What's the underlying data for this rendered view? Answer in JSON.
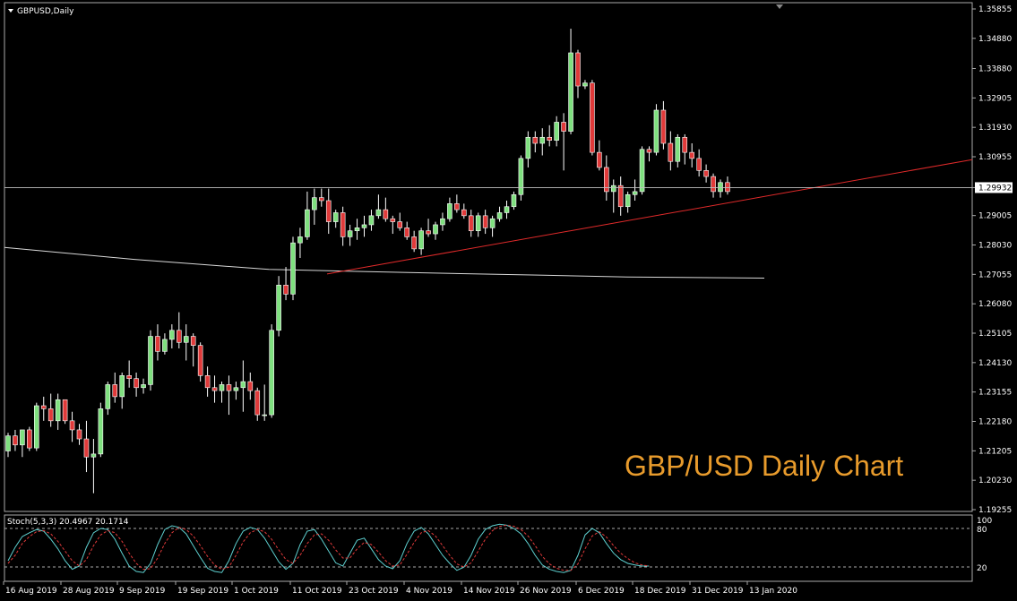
{
  "window": {
    "symbol_label": "GBPUSD,Daily"
  },
  "indicator": {
    "label": "Stoch(5,3,3) 20.4967 20.1714",
    "level_high": "80",
    "level_low": "20",
    "max": "100"
  },
  "watermark": "GBP/USD Daily Chart",
  "colors": {
    "background": "#000000",
    "bull": "#7fe07f",
    "bear": "#e03a3a",
    "trendline": "#e02a2a",
    "ma": "#d8d8d8",
    "stoch_main": "#5ed0d0",
    "stoch_signal": "#e03a3a",
    "watermark": "#e89b2c",
    "bid_line": "#c0c0c0"
  },
  "chart_data": {
    "type": "candlestick",
    "symbol": "GBPUSD",
    "timeframe": "Daily",
    "current_price": "1.29932",
    "y_ticks": [
      "1.35855",
      "1.34880",
      "1.33880",
      "1.32905",
      "1.31930",
      "1.30955",
      "1.29932",
      "1.29005",
      "1.28030",
      "1.27055",
      "1.26080",
      "1.25105",
      "1.24130",
      "1.23155",
      "1.22180",
      "1.21205",
      "1.20230",
      "1.19255"
    ],
    "ylim": [
      1.19255,
      1.35855
    ],
    "x_ticks": [
      "16 Aug 2019",
      "28 Aug 2019",
      "9 Sep 2019",
      "19 Sep 2019",
      "1 Oct 2019",
      "11 Oct 2019",
      "23 Oct 2019",
      "4 Nov 2019",
      "14 Nov 2019",
      "26 Nov 2019",
      "6 Dec 2019",
      "18 Dec 2019",
      "31 Dec 2019",
      "13 Jan 2020"
    ],
    "candles": [
      [
        1.212,
        1.218,
        1.21,
        1.217
      ],
      [
        1.217,
        1.219,
        1.212,
        1.214
      ],
      [
        1.214,
        1.219,
        1.21,
        1.219
      ],
      [
        1.219,
        1.22,
        1.212,
        1.213
      ],
      [
        1.213,
        1.228,
        1.212,
        1.227
      ],
      [
        1.227,
        1.23,
        1.222,
        1.226
      ],
      [
        1.226,
        1.231,
        1.22,
        1.222
      ],
      [
        1.222,
        1.231,
        1.219,
        1.229
      ],
      [
        1.229,
        1.229,
        1.221,
        1.222
      ],
      [
        1.222,
        1.225,
        1.215,
        1.219
      ],
      [
        1.219,
        1.221,
        1.214,
        1.216
      ],
      [
        1.216,
        1.222,
        1.205,
        1.21
      ],
      [
        1.21,
        1.216,
        1.198,
        1.211
      ],
      [
        1.211,
        1.228,
        1.21,
        1.226
      ],
      [
        1.226,
        1.235,
        1.224,
        1.234
      ],
      [
        1.234,
        1.238,
        1.228,
        1.23
      ],
      [
        1.23,
        1.238,
        1.226,
        1.237
      ],
      [
        1.237,
        1.242,
        1.233,
        1.236
      ],
      [
        1.236,
        1.238,
        1.23,
        1.233
      ],
      [
        1.233,
        1.236,
        1.231,
        1.234
      ],
      [
        1.234,
        1.252,
        1.232,
        1.25
      ],
      [
        1.25,
        1.254,
        1.242,
        1.245
      ],
      [
        1.245,
        1.251,
        1.244,
        1.249
      ],
      [
        1.249,
        1.254,
        1.246,
        1.252
      ],
      [
        1.252,
        1.258,
        1.246,
        1.248
      ],
      [
        1.248,
        1.254,
        1.242,
        1.25
      ],
      [
        1.25,
        1.251,
        1.24,
        1.247
      ],
      [
        1.247,
        1.248,
        1.235,
        1.237
      ],
      [
        1.237,
        1.24,
        1.23,
        1.233
      ],
      [
        1.233,
        1.237,
        1.228,
        1.232
      ],
      [
        1.232,
        1.235,
        1.228,
        1.234
      ],
      [
        1.234,
        1.237,
        1.224,
        1.232
      ],
      [
        1.232,
        1.235,
        1.229,
        1.233
      ],
      [
        1.233,
        1.242,
        1.225,
        1.235
      ],
      [
        1.235,
        1.238,
        1.229,
        1.232
      ],
      [
        1.232,
        1.233,
        1.222,
        1.224
      ],
      [
        1.224,
        1.234,
        1.222,
        1.224
      ],
      [
        1.224,
        1.254,
        1.223,
        1.252
      ],
      [
        1.252,
        1.27,
        1.25,
        1.267
      ],
      [
        1.267,
        1.273,
        1.262,
        1.264
      ],
      [
        1.264,
        1.283,
        1.262,
        1.281
      ],
      [
        1.281,
        1.286,
        1.276,
        1.283
      ],
      [
        1.283,
        1.298,
        1.282,
        1.292
      ],
      [
        1.292,
        1.299,
        1.287,
        1.296
      ],
      [
        1.296,
        1.299,
        1.293,
        1.295
      ],
      [
        1.295,
        1.299,
        1.284,
        1.288
      ],
      [
        1.288,
        1.292,
        1.286,
        1.291
      ],
      [
        1.291,
        1.293,
        1.28,
        1.283
      ],
      [
        1.283,
        1.287,
        1.28,
        1.285
      ],
      [
        1.285,
        1.289,
        1.282,
        1.286
      ],
      [
        1.286,
        1.29,
        1.283,
        1.287
      ],
      [
        1.287,
        1.292,
        1.285,
        1.29
      ],
      [
        1.29,
        1.297,
        1.289,
        1.292
      ],
      [
        1.292,
        1.296,
        1.288,
        1.289
      ],
      [
        1.289,
        1.29,
        1.284,
        1.288
      ],
      [
        1.288,
        1.291,
        1.285,
        1.286
      ],
      [
        1.286,
        1.288,
        1.282,
        1.283
      ],
      [
        1.283,
        1.285,
        1.278,
        1.279
      ],
      [
        1.279,
        1.286,
        1.277,
        1.285
      ],
      [
        1.285,
        1.289,
        1.283,
        1.284
      ],
      [
        1.284,
        1.288,
        1.282,
        1.287
      ],
      [
        1.287,
        1.291,
        1.285,
        1.289
      ],
      [
        1.289,
        1.296,
        1.288,
        1.294
      ],
      [
        1.294,
        1.297,
        1.291,
        1.292
      ],
      [
        1.292,
        1.294,
        1.289,
        1.29
      ],
      [
        1.29,
        1.292,
        1.283,
        1.285
      ],
      [
        1.285,
        1.291,
        1.283,
        1.29
      ],
      [
        1.29,
        1.292,
        1.284,
        1.286
      ],
      [
        1.286,
        1.29,
        1.283,
        1.289
      ],
      [
        1.289,
        1.293,
        1.288,
        1.291
      ],
      [
        1.291,
        1.295,
        1.289,
        1.293
      ],
      [
        1.293,
        1.298,
        1.292,
        1.297
      ],
      [
        1.297,
        1.31,
        1.295,
        1.309
      ],
      [
        1.309,
        1.318,
        1.306,
        1.316
      ],
      [
        1.316,
        1.318,
        1.311,
        1.314
      ],
      [
        1.314,
        1.319,
        1.31,
        1.316
      ],
      [
        1.316,
        1.32,
        1.313,
        1.315
      ],
      [
        1.315,
        1.323,
        1.313,
        1.321
      ],
      [
        1.321,
        1.324,
        1.305,
        1.318
      ],
      [
        1.318,
        1.352,
        1.317,
        1.344
      ],
      [
        1.344,
        1.345,
        1.329,
        1.333
      ],
      [
        1.333,
        1.335,
        1.332,
        1.334
      ],
      [
        1.334,
        1.335,
        1.31,
        1.311
      ],
      [
        1.311,
        1.315,
        1.305,
        1.306
      ],
      [
        1.306,
        1.31,
        1.295,
        1.298
      ],
      [
        1.298,
        1.302,
        1.291,
        1.3
      ],
      [
        1.3,
        1.303,
        1.29,
        1.293
      ],
      [
        1.293,
        1.298,
        1.291,
        1.297
      ],
      [
        1.297,
        1.302,
        1.295,
        1.298
      ],
      [
        1.298,
        1.313,
        1.297,
        1.312
      ],
      [
        1.312,
        1.313,
        1.308,
        1.311
      ],
      [
        1.311,
        1.327,
        1.31,
        1.325
      ],
      [
        1.325,
        1.328,
        1.312,
        1.314
      ],
      [
        1.314,
        1.318,
        1.305,
        1.308
      ],
      [
        1.308,
        1.317,
        1.306,
        1.316
      ],
      [
        1.316,
        1.317,
        1.307,
        1.311
      ],
      [
        1.311,
        1.314,
        1.306,
        1.309
      ],
      [
        1.309,
        1.312,
        1.303,
        1.305
      ],
      [
        1.305,
        1.307,
        1.301,
        1.303
      ],
      [
        1.303,
        1.304,
        1.296,
        1.298
      ],
      [
        1.298,
        1.302,
        1.296,
        1.301
      ],
      [
        1.301,
        1.303,
        1.297,
        1.298
      ]
    ],
    "ma_line": {
      "x_dates": [
        "16 Aug 2019",
        "23 Oct 2019",
        "31 Dec 2019",
        "13 Jan 2020"
      ],
      "y": [
        1.2795,
        1.2717,
        1.2695,
        1.2695
      ]
    },
    "trendline": {
      "x_dates": [
        "14 Oct 2019",
        "16 Jan 2020 +"
      ],
      "y": [
        1.2707,
        1.3086
      ]
    },
    "stochastic": {
      "main": [
        30,
        55,
        75,
        82,
        88,
        85,
        70,
        52,
        30,
        14,
        20,
        55,
        82,
        90,
        88,
        70,
        44,
        20,
        10,
        8,
        25,
        60,
        88,
        95,
        92,
        80,
        58,
        36,
        16,
        10,
        8,
        30,
        62,
        85,
        92,
        88,
        72,
        50,
        28,
        14,
        25,
        60,
        85,
        88,
        70,
        48,
        26,
        20,
        44,
        68,
        72,
        52,
        32,
        20,
        15,
        30,
        62,
        85,
        92,
        80,
        60,
        40,
        25,
        12,
        18,
        40,
        70,
        88,
        95,
        98,
        96,
        90,
        80,
        62,
        40,
        22,
        14,
        10,
        8,
        12,
        40,
        78,
        90,
        82,
        62,
        44,
        32,
        25,
        22,
        20,
        20
      ],
      "signal": [
        25,
        40,
        62,
        75,
        84,
        86,
        80,
        66,
        48,
        30,
        20,
        32,
        58,
        78,
        86,
        82,
        66,
        44,
        25,
        14,
        15,
        35,
        62,
        82,
        92,
        88,
        76,
        58,
        38,
        22,
        14,
        18,
        40,
        65,
        82,
        88,
        84,
        70,
        50,
        32,
        25,
        40,
        62,
        78,
        80,
        68,
        50,
        35,
        35,
        52,
        64,
        60,
        46,
        30,
        20,
        22,
        42,
        64,
        82,
        86,
        76,
        58,
        40,
        24,
        18,
        26,
        48,
        70,
        86,
        94,
        96,
        94,
        88,
        76,
        58,
        38,
        24,
        16,
        12,
        12,
        24,
        52,
        76,
        84,
        74,
        58,
        44,
        34,
        26,
        22,
        20
      ]
    }
  }
}
